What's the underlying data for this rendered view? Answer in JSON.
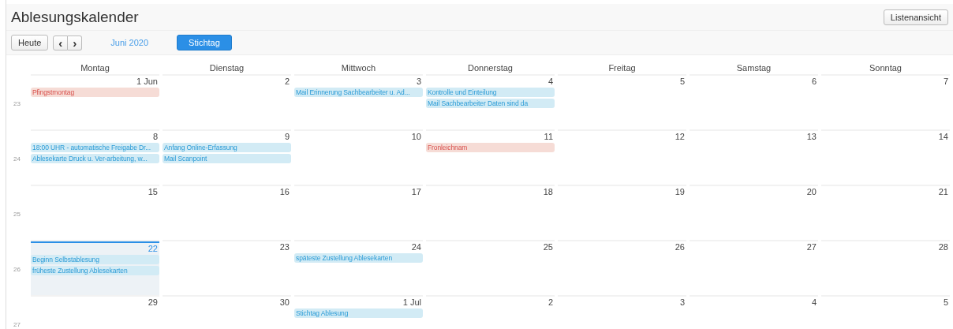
{
  "title": "Ablesungskalender",
  "view_button": "Listenansicht",
  "toolbar": {
    "today_button": "Heute",
    "prev_icon": "‹",
    "next_icon": "›",
    "month": "Juni 2020",
    "deadline_button": "Stichtag"
  },
  "weekdays": [
    "Montag",
    "Dienstag",
    "Mittwoch",
    "Donnerstag",
    "Freitag",
    "Samstag",
    "Sonntag"
  ],
  "weeks": [
    {
      "number": "23",
      "days": [
        {
          "label": "1 Jun",
          "today": false,
          "events": [
            {
              "title": "Pfingstmontag",
              "kind": "holiday"
            }
          ]
        },
        {
          "label": "2",
          "today": false
        },
        {
          "label": "3",
          "today": false,
          "events": [
            {
              "title": "Mail Erinnerung Sachbearbeiter u. Ad...",
              "kind": "task"
            }
          ]
        },
        {
          "label": "4",
          "today": false,
          "events": [
            {
              "title": "Kontrolle und Einteilung",
              "kind": "task"
            },
            {
              "title": "Mail Sachbearbeiter Daten sind da",
              "kind": "task"
            }
          ]
        },
        {
          "label": "5",
          "today": false
        },
        {
          "label": "6",
          "today": false
        },
        {
          "label": "7",
          "today": false
        }
      ]
    },
    {
      "number": "24",
      "days": [
        {
          "label": "8",
          "today": false,
          "events": [
            {
              "title": "18:00 UHR - automatische Freigabe Dr...",
              "kind": "task"
            },
            {
              "title": "Ablesekarte Druck u. Ver-arbeitung, w...",
              "kind": "task"
            }
          ]
        },
        {
          "label": "9",
          "today": false,
          "events": [
            {
              "title": "Anfang Online-Erfassung",
              "kind": "task"
            },
            {
              "title": "Mail Scanpoint",
              "kind": "task"
            }
          ]
        },
        {
          "label": "10",
          "today": false
        },
        {
          "label": "11",
          "today": false,
          "events": [
            {
              "title": "Fronleichnam",
              "kind": "holiday"
            }
          ]
        },
        {
          "label": "12",
          "today": false
        },
        {
          "label": "13",
          "today": false
        },
        {
          "label": "14",
          "today": false
        }
      ]
    },
    {
      "number": "25",
      "days": [
        {
          "label": "15",
          "today": false
        },
        {
          "label": "16",
          "today": false
        },
        {
          "label": "17",
          "today": false
        },
        {
          "label": "18",
          "today": false
        },
        {
          "label": "19",
          "today": false
        },
        {
          "label": "20",
          "today": false
        },
        {
          "label": "21",
          "today": false
        }
      ]
    },
    {
      "number": "26",
      "days": [
        {
          "label": "22",
          "today": true,
          "events": [
            {
              "title": "Beginn Selbstablesung",
              "kind": "task"
            },
            {
              "title": "früheste Zustellung Ablesekarten",
              "kind": "task"
            }
          ]
        },
        {
          "label": "23",
          "today": false
        },
        {
          "label": "24",
          "today": false,
          "events": [
            {
              "title": "späteste Zustellung Ablesekarten",
              "kind": "task"
            }
          ]
        },
        {
          "label": "25",
          "today": false
        },
        {
          "label": "26",
          "today": false
        },
        {
          "label": "27",
          "today": false
        },
        {
          "label": "28",
          "today": false
        }
      ]
    },
    {
      "number": "27",
      "days": [
        {
          "label": "29",
          "today": false
        },
        {
          "label": "30",
          "today": false
        },
        {
          "label": "1 Jul",
          "today": false,
          "events": [
            {
              "title": "Stichtag Ablesung",
              "kind": "task"
            }
          ]
        },
        {
          "label": "2",
          "today": false
        },
        {
          "label": "3",
          "today": false
        },
        {
          "label": "4",
          "today": false
        },
        {
          "label": "5",
          "today": false
        }
      ]
    }
  ]
}
